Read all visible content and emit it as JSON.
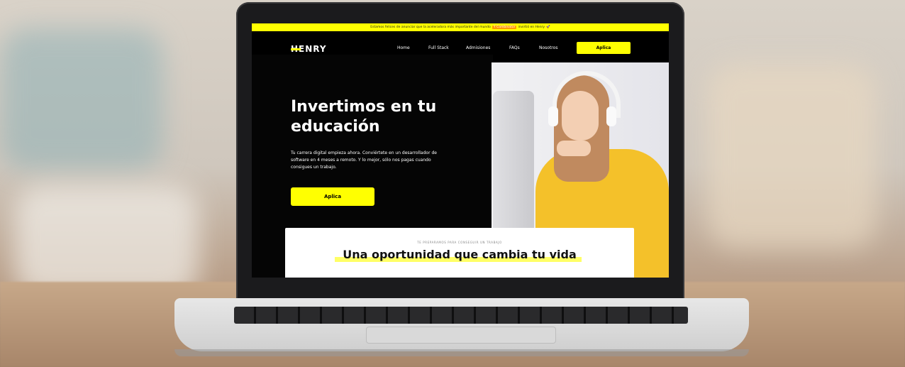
{
  "announcement": {
    "text_before": "Estamos felices de anunciar que la aceleradora más importante del mundo",
    "brand": "Y Combinator",
    "text_after": "invirtió en Henry",
    "emoji": "🚀"
  },
  "nav": {
    "logo": "HENRY",
    "items": [
      "Home",
      "Full Stack",
      "Admisiones",
      "FAQs",
      "Nosotros"
    ],
    "cta": "Aplica"
  },
  "hero": {
    "title_line1": "Invertimos en tu",
    "title_line2": "educación",
    "description": "Tu carrera digital empieza ahora. Conviértete en un desarrollador de software en 4 meses a remoto. Y lo mejor, sólo nos pagas cuando consigues un trabajo.",
    "cta": "Aplica"
  },
  "section": {
    "eyebrow": "TE PREPARAMOS PARA CONSEGUIR UN TRABAJO",
    "title": "Una oportunidad que cambia tu vida"
  },
  "colors": {
    "accent": "#ffff01",
    "dark": "#000000"
  }
}
